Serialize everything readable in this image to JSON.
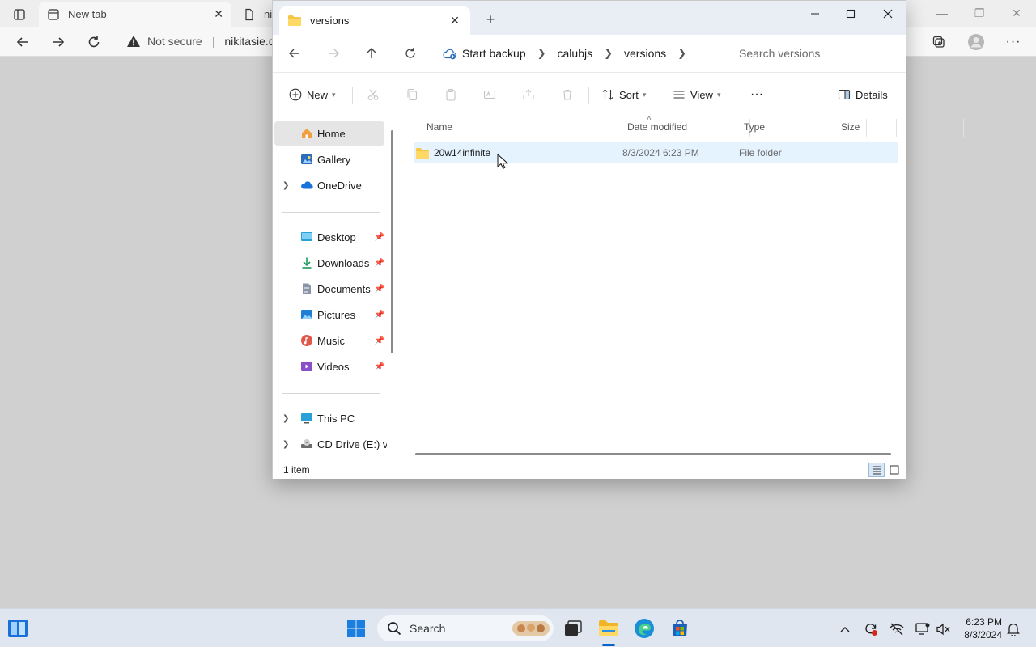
{
  "browser": {
    "tab1_title": "New tab",
    "tab2_title": "nik",
    "not_secure_label": "Not secure",
    "address_text": "nikitasie.d"
  },
  "explorer": {
    "tab_title": "versions",
    "breadcrumb": [
      "Start backup",
      "calubjs",
      "versions"
    ],
    "search_placeholder": "Search versions",
    "commands": {
      "new_label": "New",
      "sort_label": "Sort",
      "view_label": "View",
      "more_label": "···",
      "details_label": "Details"
    },
    "nav_pane": {
      "items": [
        {
          "label": "Home",
          "icon": "home-icon",
          "selected": true
        },
        {
          "label": "Gallery",
          "icon": "gallery-icon"
        },
        {
          "label": "OneDrive",
          "icon": "onedrive-icon",
          "expandable": true
        }
      ],
      "quick_access": [
        {
          "label": "Desktop",
          "icon": "desktop-icon",
          "pinned": true
        },
        {
          "label": "Downloads",
          "icon": "downloads-icon",
          "pinned": true
        },
        {
          "label": "Documents",
          "icon": "documents-icon",
          "pinned": true
        },
        {
          "label": "Pictures",
          "icon": "pictures-icon",
          "pinned": true
        },
        {
          "label": "Music",
          "icon": "music-icon",
          "pinned": true
        },
        {
          "label": "Videos",
          "icon": "videos-icon",
          "pinned": true
        }
      ],
      "drives": [
        {
          "label": "This PC",
          "icon": "this-pc-icon"
        },
        {
          "label": "CD Drive (E:) virt",
          "icon": "cd-drive-icon"
        }
      ]
    },
    "columns": {
      "name": "Name",
      "date_modified": "Date modified",
      "type": "Type",
      "size": "Size"
    },
    "rows": [
      {
        "name": "20w14infinite",
        "date_modified": "8/3/2024 6:23 PM",
        "type": "File folder",
        "size": ""
      }
    ],
    "status": "1 item"
  },
  "taskbar": {
    "search_placeholder": "Search",
    "time": "6:23 PM",
    "date": "8/3/2024"
  },
  "colors": {
    "accent": "#0a64c8",
    "selection": "#e5f3ff",
    "folder": "#f5c64a"
  }
}
